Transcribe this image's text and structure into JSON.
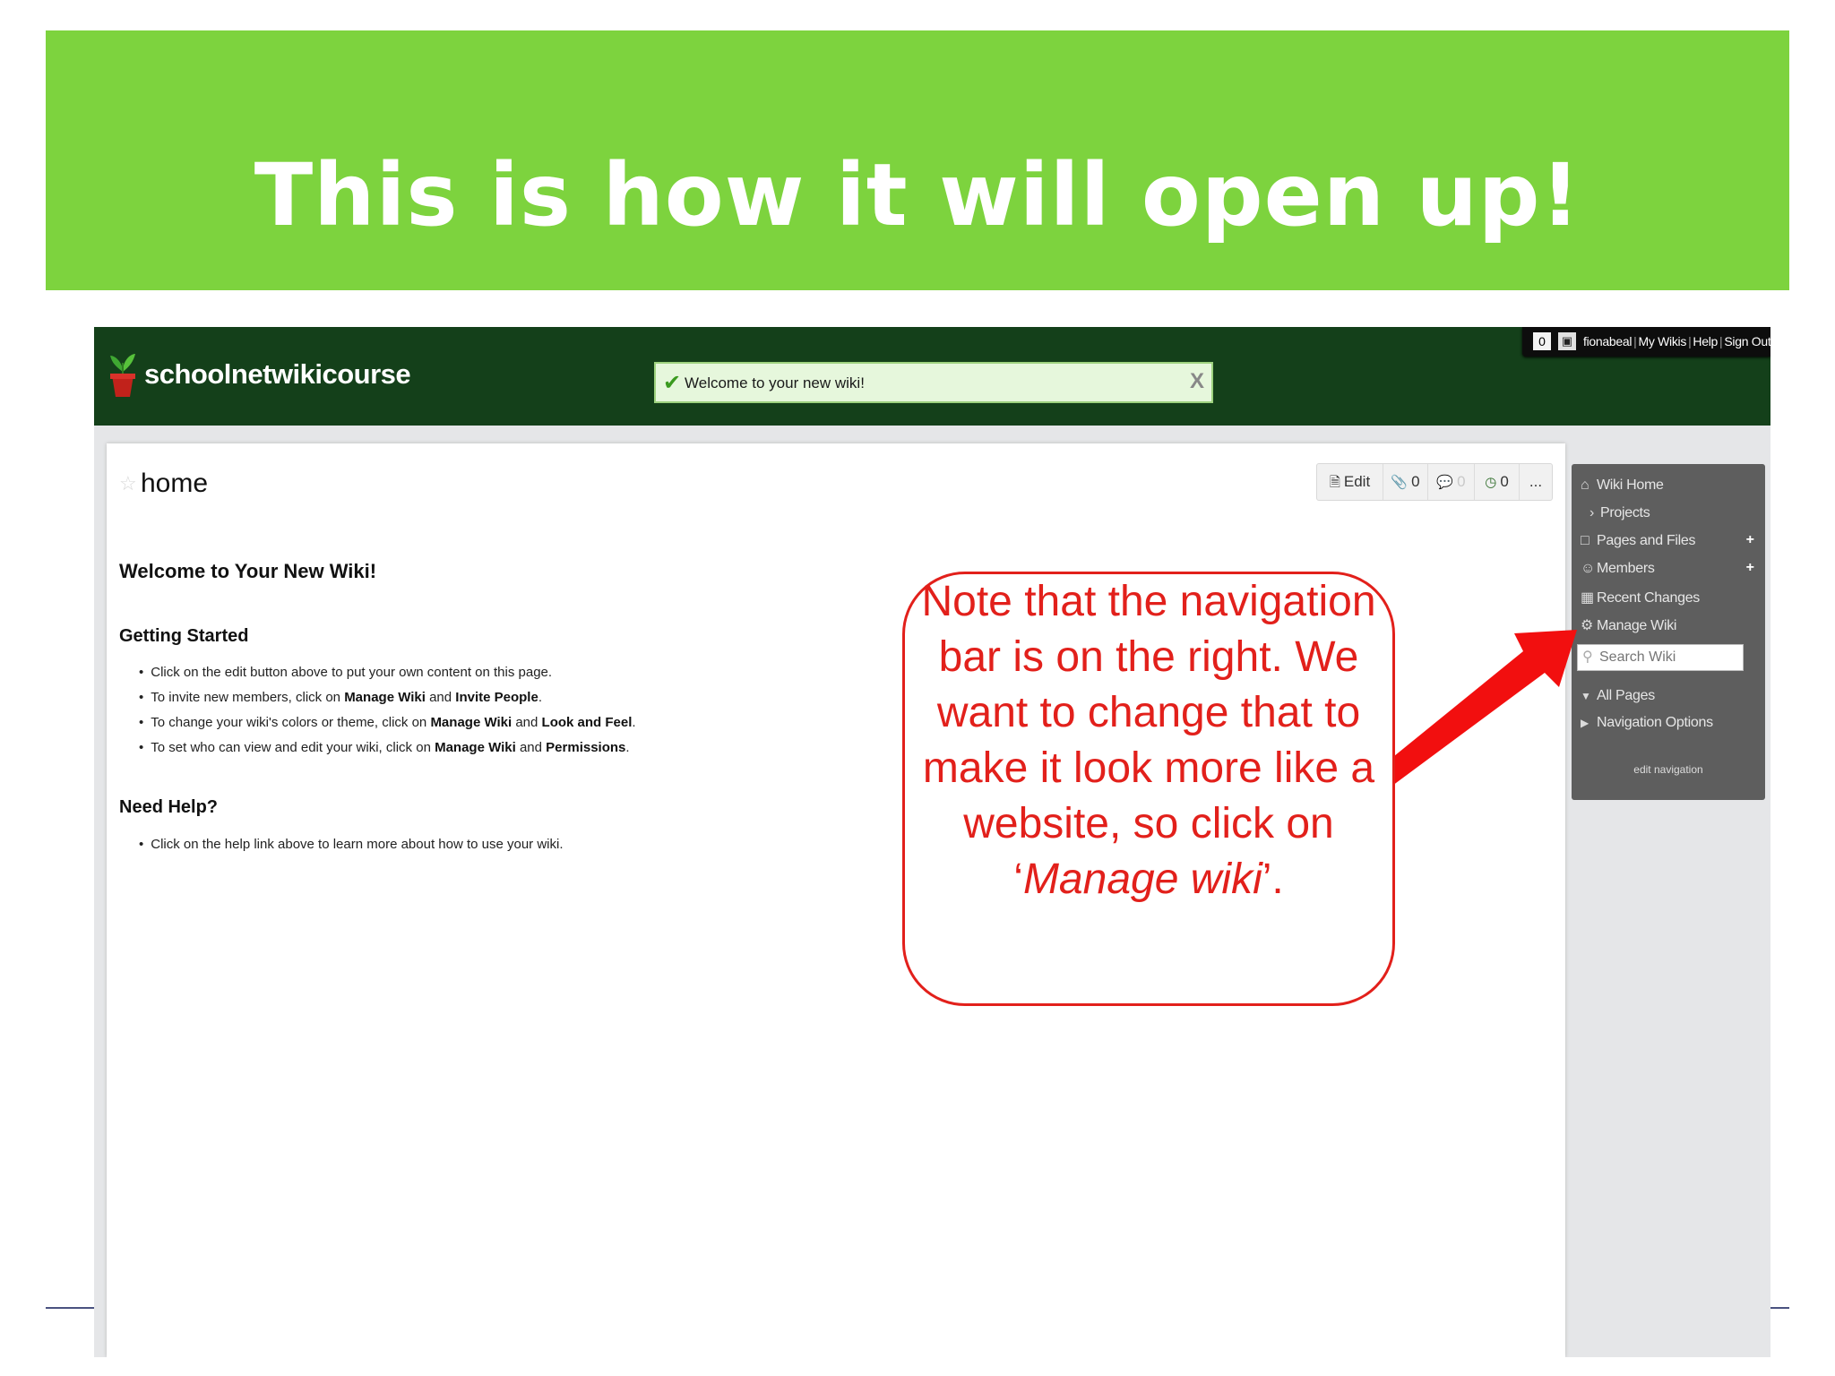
{
  "slide": {
    "title": "This is how it will open up!",
    "colors": {
      "banner": "#7dd33e",
      "callout": "#e2201b",
      "wiki_header": "#14401a"
    }
  },
  "wiki": {
    "site_name": "schoolnetwikicourse",
    "notice": {
      "text": "Welcome to your new wiki!",
      "close_label": "X"
    },
    "userbar": {
      "count": "0",
      "username": "fionabeal",
      "links": [
        "My Wikis",
        "Help",
        "Sign Out"
      ]
    },
    "page": {
      "title": "home",
      "toolbar": [
        {
          "icon": "edit-icon",
          "label": "Edit"
        },
        {
          "icon": "attachment-icon",
          "label": "0"
        },
        {
          "icon": "comment-icon",
          "label": "0"
        },
        {
          "icon": "history-icon",
          "label": "0"
        },
        {
          "icon": "more-icon",
          "label": "..."
        }
      ],
      "welcome_heading": "Welcome to Your New Wiki!",
      "getting_started": {
        "heading": "Getting Started",
        "items": [
          {
            "text": "Click on the edit button above to put your own content on this page."
          },
          {
            "before": "To invite new members, click on ",
            "k1": "Manage Wiki",
            "mid": " and ",
            "k2": "Invite People",
            "after": "."
          },
          {
            "before": "To change your wiki's colors or theme, click on ",
            "k1": "Manage Wiki",
            "mid": " and ",
            "k2": "Look and Feel",
            "after": "."
          },
          {
            "before": "To set who can view and edit your wiki, click on ",
            "k1": "Manage Wiki",
            "mid": " and ",
            "k2": "Permissions",
            "after": "."
          }
        ]
      },
      "need_help": {
        "heading": "Need Help?",
        "items": [
          {
            "text": "Click on the help link above to learn more about how to use your wiki."
          }
        ]
      }
    },
    "nav": {
      "items": [
        {
          "icon": "home-icon",
          "label": "Wiki Home"
        },
        {
          "icon": "chevron-right-icon",
          "label": "Projects"
        },
        {
          "icon": "folder-icon",
          "label": "Pages and Files",
          "add": "+"
        },
        {
          "icon": "members-icon",
          "label": "Members",
          "add": "+"
        },
        {
          "icon": "calendar-icon",
          "label": "Recent Changes"
        },
        {
          "icon": "gear-icon",
          "label": "Manage Wiki"
        }
      ],
      "search_placeholder": "Search Wiki",
      "all_pages": "All Pages",
      "navigation_options": "Navigation Options",
      "edit_navigation": "edit navigation"
    }
  },
  "callout": {
    "text_main": "Note that the navigation bar is on the right. We want to change that to make it look more like a website, so click on ",
    "quote_open": "‘",
    "emphasis": "Manage wiki",
    "quote_close": "’."
  }
}
